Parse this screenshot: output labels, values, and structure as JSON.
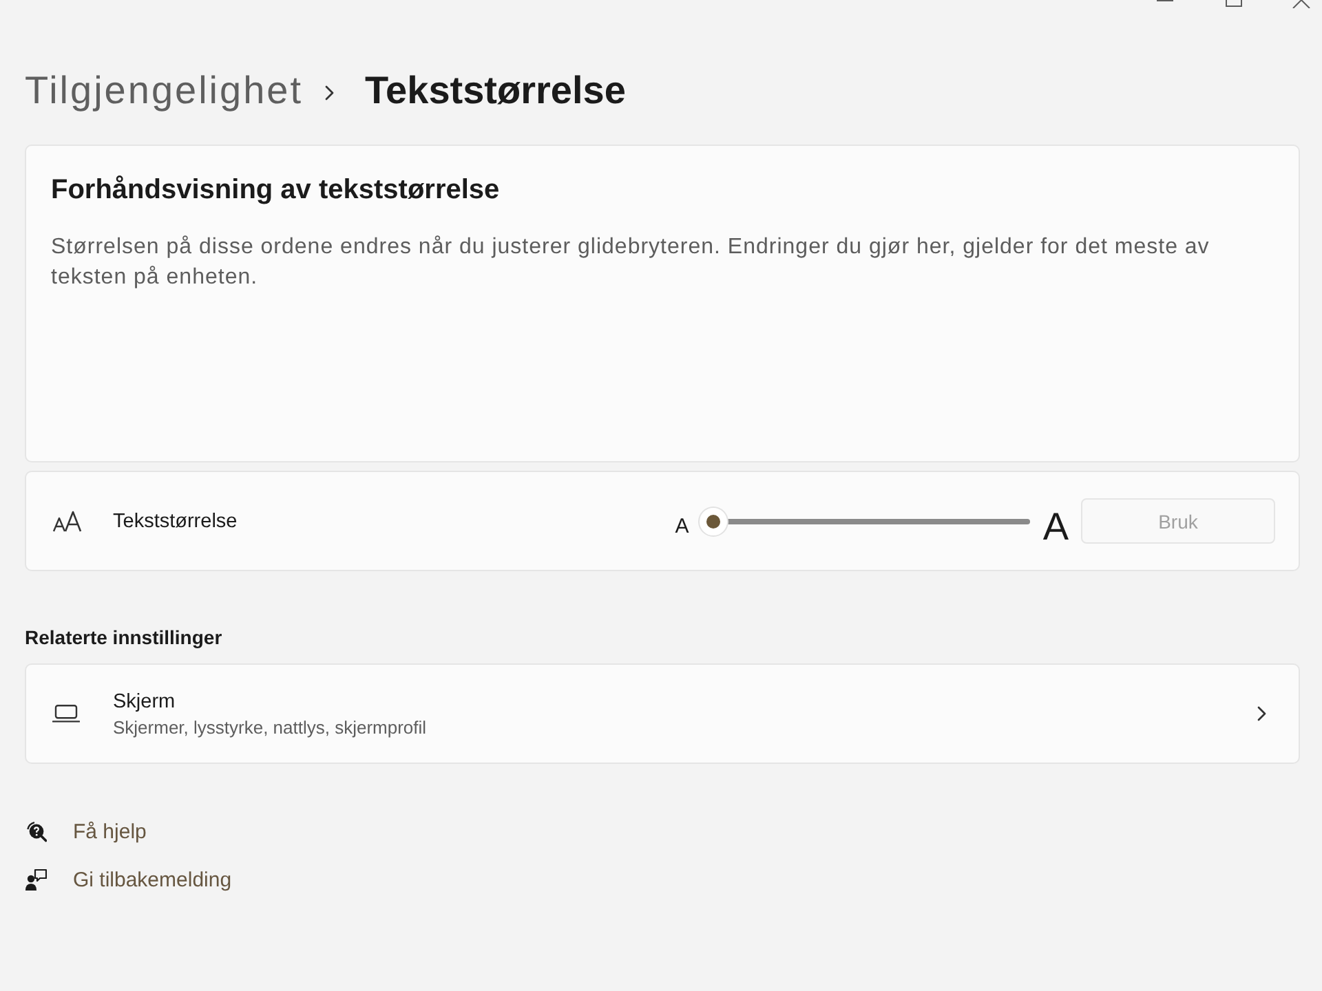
{
  "breadcrumb": [
    {
      "label": "Tilgjengelighet",
      "current": false
    },
    {
      "label": "Tekststørrelse",
      "current": true
    }
  ],
  "preview": {
    "title": "Forhåndsvisning av tekststørrelse",
    "text": "Størrelsen på disse ordene endres når du justerer glidebryteren. Endringer du gjør her, gjelder for det meste av teksten på enheten."
  },
  "text_size": {
    "label": "Tekststørrelse",
    "slider": {
      "min_label": "A",
      "max_label": "A",
      "level": 0
    },
    "apply_button": {
      "label": "Bruk",
      "disabled": true
    }
  },
  "related": {
    "heading": "Relaterte innstillinger",
    "items": [
      {
        "title": "Skjerm",
        "subtitle": "Skjermer, lysstyrke, nattlys, skjermprofil"
      }
    ]
  },
  "links": [
    {
      "kind": "help",
      "label": "Få hjelp"
    },
    {
      "kind": "feedback",
      "label": "Gi tilbakemelding"
    }
  ]
}
